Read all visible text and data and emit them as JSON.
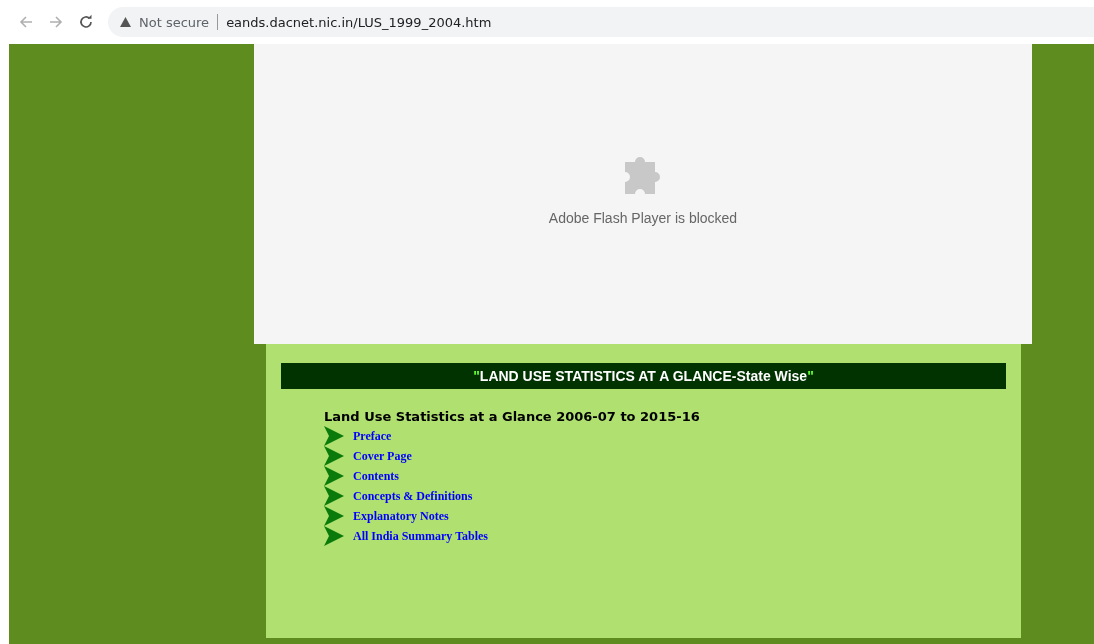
{
  "browser": {
    "security_label": "Not secure",
    "url": "eands.dacnet.nic.in/LUS_1999_2004.htm"
  },
  "plugin": {
    "message": "Adobe Flash Player is blocked"
  },
  "banner": {
    "quote_open": "\"",
    "text": "LAND USE STATISTICS AT A GLANCE-State Wise",
    "quote_close": "\""
  },
  "heading": "Land Use Statistics at a Glance 2006-07 to 2015-16",
  "links": [
    "Preface",
    "Cover Page",
    "Contents",
    "Concepts & Definitions",
    "Explanatory Notes",
    "All India Summary Tables"
  ]
}
